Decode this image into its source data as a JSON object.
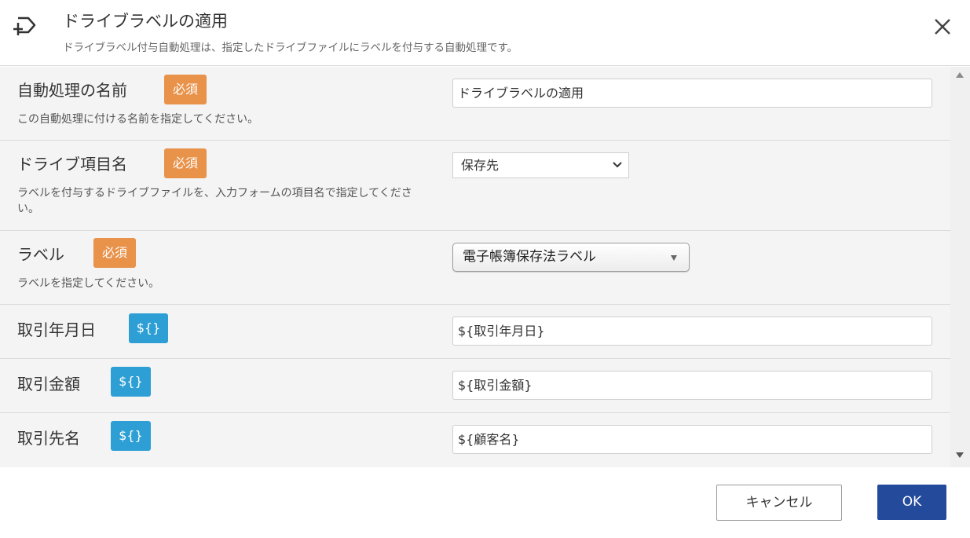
{
  "header": {
    "title": "ドライブラベルの適用",
    "subtitle": "ドライブラベル付与自動処理は、指定したドライブファイルにラベルを付与する自動処理です。",
    "icon": "drive-label-icon",
    "close_icon": "close-icon"
  },
  "badges": {
    "required": "必須",
    "variable": "${}"
  },
  "fields": {
    "name": {
      "label": "自動処理の名前",
      "description": "この自動処理に付ける名前を指定してください。",
      "value": "ドライブラベルの適用"
    },
    "drive_item": {
      "label": "ドライブ項目名",
      "description": "ラベルを付与するドライブファイルを、入力フォームの項目名で指定してください。",
      "selected": "保存先"
    },
    "label": {
      "label": "ラベル",
      "description": "ラベルを指定してください。",
      "selected": "電子帳簿保存法ラベル"
    },
    "trade_date": {
      "label": "取引年月日",
      "value": "${取引年月日}"
    },
    "trade_amount": {
      "label": "取引金額",
      "value": "${取引金額}"
    },
    "trade_partner": {
      "label": "取引先名",
      "value": "${顧客名}"
    }
  },
  "footer": {
    "cancel_label": "キャンセル",
    "ok_label": "OK"
  },
  "colors": {
    "required_badge": "#e8924a",
    "variable_badge": "#2e9fd4",
    "primary_button": "#244a9b"
  }
}
